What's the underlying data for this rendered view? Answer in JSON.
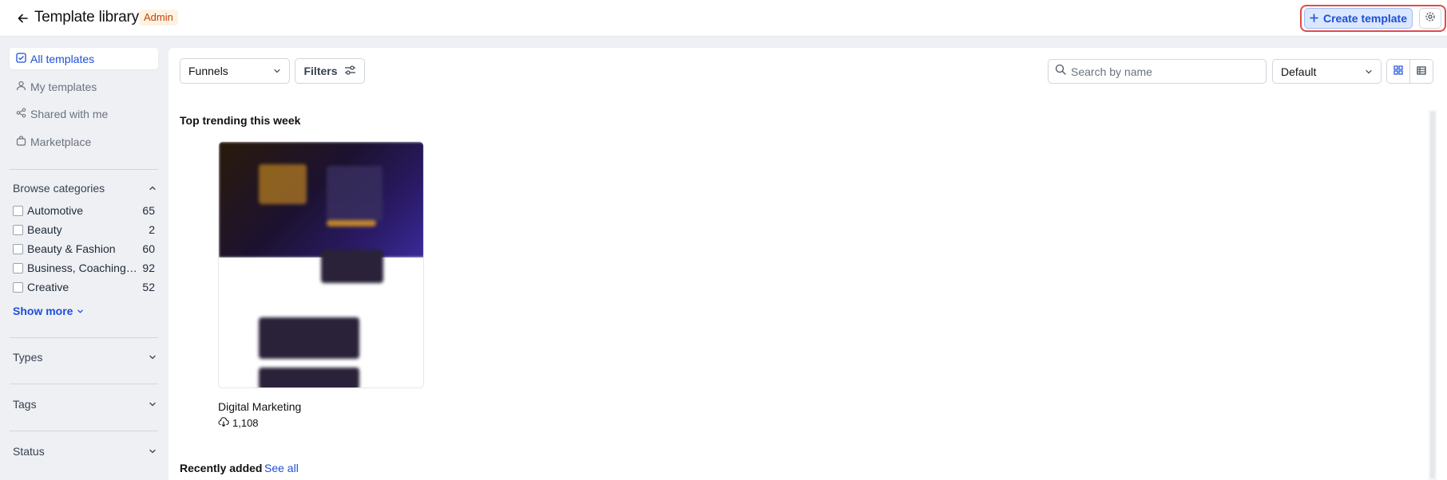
{
  "header": {
    "title": "Template library",
    "badge": "Admin",
    "create_label": "Create template"
  },
  "sidebar": {
    "nav": [
      {
        "label": "All templates",
        "icon": "checkbox-icon",
        "active": true
      },
      {
        "label": "My templates",
        "icon": "user-icon",
        "active": false
      },
      {
        "label": "Shared with me",
        "icon": "share-icon",
        "active": false
      },
      {
        "label": "Marketplace",
        "icon": "bag-icon",
        "active": false
      }
    ],
    "browse_title": "Browse categories",
    "categories": [
      {
        "name": "Automotive",
        "count": "65"
      },
      {
        "name": "Beauty",
        "count": "2"
      },
      {
        "name": "Beauty & Fashion",
        "count": "60"
      },
      {
        "name": "Business, Coaching & Consulting",
        "count": "92"
      },
      {
        "name": "Creative",
        "count": "52"
      }
    ],
    "show_more": "Show more",
    "sections": [
      "Types",
      "Tags",
      "Status"
    ]
  },
  "toolbar": {
    "type_select": "Funnels",
    "filters_label": "Filters",
    "search_placeholder": "Search by name",
    "sort_select": "Default"
  },
  "main": {
    "trending_title": "Top trending this week",
    "card": {
      "title": "Digital Marketing",
      "downloads": "1,108"
    },
    "recent_title": "Recently added",
    "see_all": "See all"
  },
  "colors": {
    "accent": "#1d4fd8",
    "highlight": "#e04b4b",
    "badge_bg": "#fef3e2",
    "badge_text": "#c2410c"
  }
}
